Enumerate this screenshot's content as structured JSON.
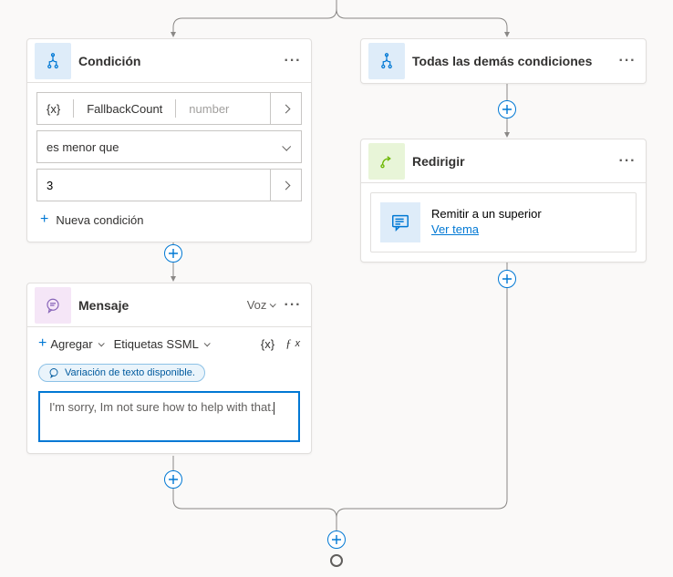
{
  "condition_card": {
    "title": "Condición",
    "variable_token": "{x}",
    "variable_name": "FallbackCount",
    "variable_type": "number",
    "operator": "es menor que",
    "value": "3",
    "new_condition": "Nueva condición"
  },
  "other_conditions_card": {
    "title": "Todas las demás condiciones"
  },
  "redirect_card": {
    "title": "Redirigir",
    "escalate_label": "Remitir a un superior",
    "escalate_link": "Ver tema"
  },
  "message_card": {
    "title": "Mensaje",
    "mode": "Voz",
    "add_label": "Agregar",
    "ssml_label": "Etiquetas SSML",
    "var_token": "{x}",
    "chip_text": "Variación de texto disponible.",
    "text_value": "I'm sorry, Im not sure how to help with that."
  }
}
